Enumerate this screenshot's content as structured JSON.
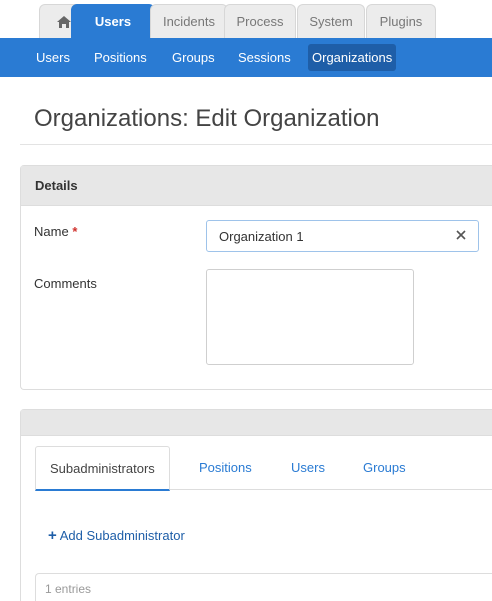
{
  "top_tabs": {
    "home_icon": "home-icon",
    "items": [
      "Users",
      "Incidents",
      "Process",
      "System",
      "Plugins"
    ]
  },
  "subnav": {
    "items": [
      "Users",
      "Positions",
      "Groups",
      "Sessions",
      "Organizations"
    ]
  },
  "page": {
    "title": "Organizations: Edit Organization"
  },
  "details": {
    "header": "Details",
    "name_label": "Name",
    "required_mark": "*",
    "name_value": "Organization 1",
    "comments_label": "Comments"
  },
  "members": {
    "tabs": [
      "Subadministrators",
      "Positions",
      "Users",
      "Groups"
    ],
    "add_label": "Add Subadministrator",
    "entries_text": "1 entries"
  },
  "colors": {
    "accent": "#2a7bd3",
    "accent_dark": "#1e5ea8",
    "required": "#d0312d"
  }
}
